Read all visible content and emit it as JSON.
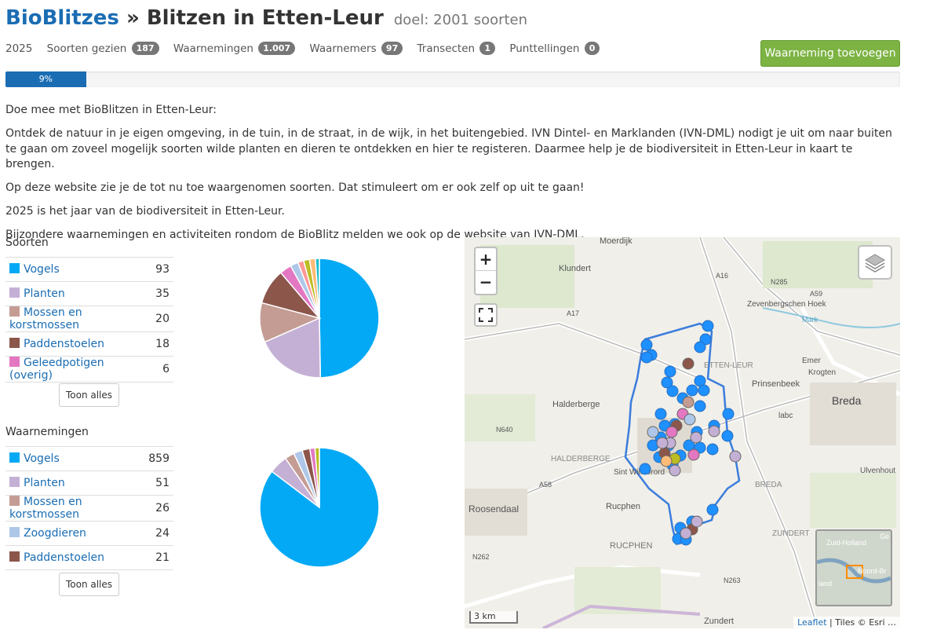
{
  "header": {
    "brand": "BioBlitzes",
    "separator": "»",
    "title": "Blitzen in Etten-Leur",
    "goal": "doel: 2001 soorten"
  },
  "stats": {
    "year": "2025",
    "items": [
      {
        "label": "Soorten gezien",
        "count": "187"
      },
      {
        "label": "Waarnemingen",
        "count": "1.007"
      },
      {
        "label": "Waarnemers",
        "count": "97"
      },
      {
        "label": "Transecten",
        "count": "1"
      },
      {
        "label": "Punttellingen",
        "count": "0"
      }
    ],
    "add_button": "Waarneming toevoegen",
    "progress_label": "9%",
    "progress_value": 0.09
  },
  "intro": {
    "p1": "Doe mee met BioBlitzen in Etten-Leur:",
    "p2": "Ontdek de natuur in je eigen omgeving, in de tuin, in de straat, in de wijk, in het buitengebied. IVN Dintel- en Marklanden (IVN-DML) nodigt je uit om naar buiten te gaan om zoveel mogelijk soorten wilde planten en dieren te ontdekken en hier te registeren. Daarmee help je de biodiversiteit in Etten-Leur in kaart te brengen.",
    "p3": "Op deze website zie je de tot nu toe waargenomen soorten. Dat stimuleert om er ook zelf op uit te gaan!",
    "p4": "2025 is het jaar van de biodiversiteit in Etten-Leur.",
    "p5": "Bijzondere waarnemingen en activiteiten rondom de BioBlitz melden we ook op de website van IVN-DML."
  },
  "species": {
    "title": "Soorten",
    "rows": [
      {
        "name": "Vogels",
        "count": "93",
        "color": "#03a9f4"
      },
      {
        "name": "Planten",
        "count": "35",
        "color": "#c5b0d5"
      },
      {
        "name": "Mossen en korstmossen",
        "count": "20",
        "color": "#c49c94"
      },
      {
        "name": "Paddenstoelen",
        "count": "18",
        "color": "#8c564b"
      },
      {
        "name": "Geleedpotigen (overig)",
        "count": "6",
        "color": "#e377c2"
      }
    ],
    "more_button": "Toon alles"
  },
  "observations": {
    "title": "Waarnemingen",
    "rows": [
      {
        "name": "Vogels",
        "count": "859",
        "color": "#03a9f4"
      },
      {
        "name": "Planten",
        "count": "51",
        "color": "#c5b0d5"
      },
      {
        "name": "Mossen en korstmossen",
        "count": "26",
        "color": "#c49c94"
      },
      {
        "name": "Zoogdieren",
        "count": "24",
        "color": "#aec7e8"
      },
      {
        "name": "Paddenstoelen",
        "count": "21",
        "color": "#8c564b"
      }
    ],
    "more_button": "Toon alles"
  },
  "chart_data": [
    {
      "type": "pie",
      "categories": [
        "Vogels",
        "Planten",
        "Mossen en korstmossen",
        "Paddenstoelen",
        "Geleedpotigen (overig)",
        "other1",
        "other2",
        "other3",
        "other4",
        "other5"
      ],
      "values": [
        93,
        35,
        20,
        18,
        6,
        4,
        3,
        3,
        3,
        2
      ],
      "colors": [
        "#03a9f4",
        "#c5b0d5",
        "#c49c94",
        "#8c564b",
        "#e377c2",
        "#aec7e8",
        "#ff9896",
        "#bcbd22",
        "#ffbb78",
        "#17becf"
      ]
    },
    {
      "type": "pie",
      "categories": [
        "Vogels",
        "Planten",
        "Mossen en korstmossen",
        "Zoogdieren",
        "Paddenstoelen",
        "other1",
        "other2"
      ],
      "values": [
        859,
        51,
        26,
        24,
        21,
        14,
        12
      ],
      "colors": [
        "#03a9f4",
        "#c5b0d5",
        "#c49c94",
        "#aec7e8",
        "#8c564b",
        "#e377c2",
        "#bcbd22"
      ]
    }
  ],
  "map": {
    "zoom_in": "+",
    "zoom_out": "−",
    "scale": "3 km",
    "attribution_link": "Leaflet",
    "attribution_text": "| Tiles © Esri …",
    "labels": [
      "Moerdijk",
      "Klundert",
      "Zevenbergschen Hoek",
      "Halderberge",
      "Prinsenbeek",
      "Breda",
      "Roosendaal",
      "Rucphen",
      "RUCPHEN",
      "Sint Willebrord",
      "Zundert",
      "Emer",
      "Krogten",
      "Ulvenhout",
      "labc",
      "HALDERBERGE",
      "BREDA",
      "ETTEN-LEUR",
      "ZUNDERT",
      "N640",
      "N285",
      "A58",
      "A59",
      "A17",
      "A16",
      "N262",
      "N263",
      "Mark"
    ],
    "minimap_labels": [
      "Zuid-Holland",
      "Noord-Br",
      "land",
      "Ge"
    ]
  }
}
